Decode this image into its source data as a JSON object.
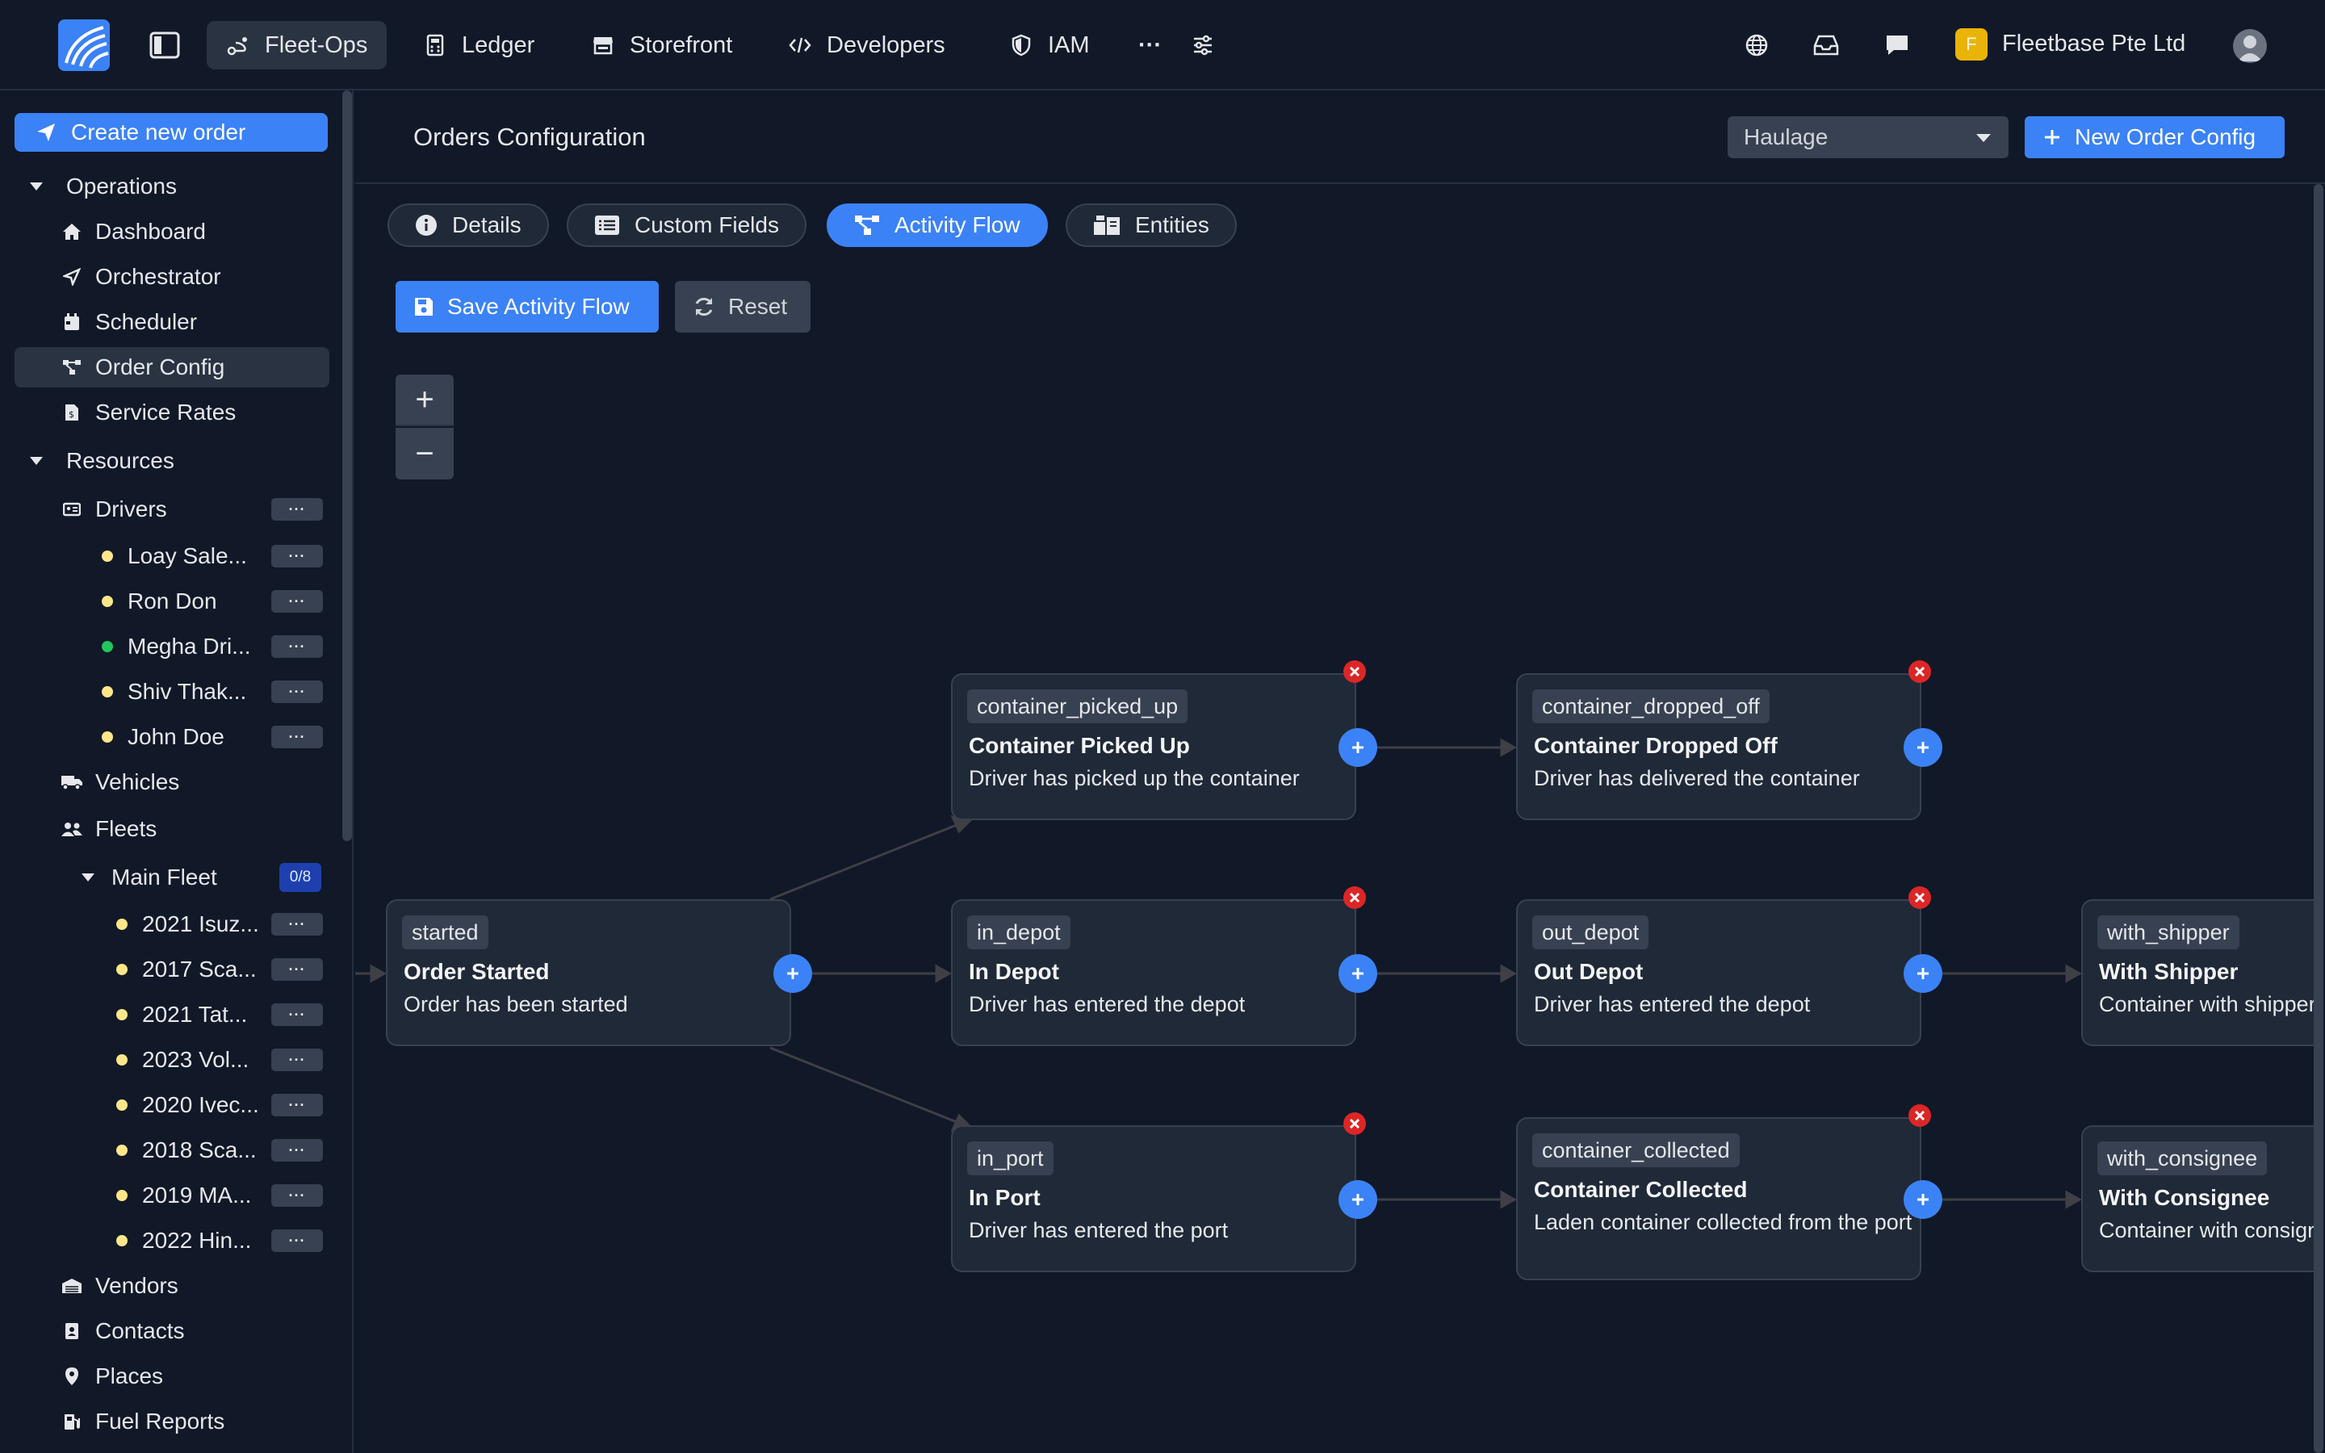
{
  "topnav": {
    "items": [
      {
        "label": "Fleet-Ops",
        "icon": "route-icon"
      },
      {
        "label": "Ledger",
        "icon": "calculator-icon"
      },
      {
        "label": "Storefront",
        "icon": "store-icon"
      },
      {
        "label": "Developers",
        "icon": "code-icon"
      },
      {
        "label": "IAM",
        "icon": "shield-icon"
      }
    ],
    "more_label": "···",
    "org_initial": "F",
    "org_name": "Fleetbase Pte Ltd"
  },
  "sidebar": {
    "create_label": "Create new order",
    "operations": {
      "label": "Operations",
      "items": [
        "Dashboard",
        "Orchestrator",
        "Scheduler",
        "Order Config",
        "Service Rates"
      ]
    },
    "resources": {
      "label": "Resources",
      "drivers_label": "Drivers",
      "drivers": [
        {
          "name": "Loay Sale...",
          "status": "yellow"
        },
        {
          "name": "Ron Don",
          "status": "yellow"
        },
        {
          "name": "Megha Dri...",
          "status": "green"
        },
        {
          "name": "Shiv Thak...",
          "status": "yellow"
        },
        {
          "name": "John Doe",
          "status": "yellow"
        }
      ],
      "vehicles_label": "Vehicles",
      "fleets_label": "Fleets",
      "main_fleet_label": "Main Fleet",
      "main_fleet_count": "0/8",
      "fleet_vehicles": [
        "2021 Isuz...",
        "2017 Sca...",
        "2021 Tat...",
        "2023 Vol...",
        "2020 Ivec...",
        "2018 Sca...",
        "2019 MA...",
        "2022 Hin..."
      ],
      "bottom_items": [
        "Vendors",
        "Contacts",
        "Places",
        "Fuel Reports"
      ]
    },
    "more_label": "···"
  },
  "header": {
    "title": "Orders Configuration",
    "select_value": "Haulage",
    "new_config_label": "New Order Config"
  },
  "tabs": [
    "Details",
    "Custom Fields",
    "Activity Flow",
    "Entities"
  ],
  "actions": {
    "save_label": "Save Activity Flow",
    "reset_label": "Reset"
  },
  "zoom": {
    "in_label": "+",
    "out_label": "−"
  },
  "flow": {
    "nodes": {
      "started": {
        "key": "started",
        "title": "Order Started",
        "desc": "Order has been started"
      },
      "container_picked_up": {
        "key": "container_picked_up",
        "title": "Container Picked Up",
        "desc": "Driver has picked up the container"
      },
      "container_dropped_off": {
        "key": "container_dropped_off",
        "title": "Container Dropped Off",
        "desc": "Driver has delivered the container"
      },
      "in_depot": {
        "key": "in_depot",
        "title": "In Depot",
        "desc": "Driver has entered the depot"
      },
      "out_depot": {
        "key": "out_depot",
        "title": "Out Depot",
        "desc": "Driver has entered the depot"
      },
      "with_shipper": {
        "key": "with_shipper",
        "title": "With Shipper",
        "desc": "Container with shipper"
      },
      "in_port": {
        "key": "in_port",
        "title": "In Port",
        "desc": "Driver has entered the port"
      },
      "container_collected": {
        "key": "container_collected",
        "title": "Container Collected",
        "desc": "Laden container collected from the port"
      },
      "with_consignee": {
        "key": "with_consignee",
        "title": "With Consignee",
        "desc": "Container with consignee"
      }
    }
  },
  "colors": {
    "accent": "#3b82f6",
    "background": "#111827",
    "node": "#1f2937",
    "danger": "#dc2626"
  }
}
